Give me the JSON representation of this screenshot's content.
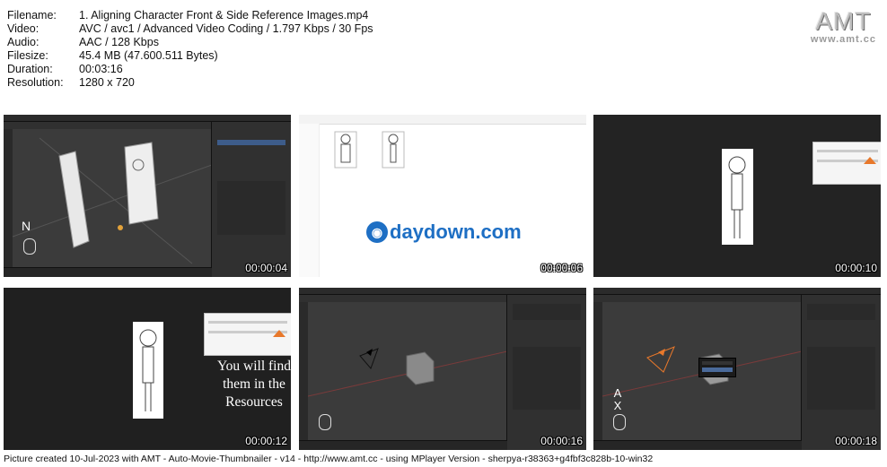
{
  "info": {
    "rows": [
      {
        "key": "Filename:",
        "value": "1. Aligning Character Front & Side Reference Images.mp4"
      },
      {
        "key": "Video:",
        "value": "AVC / avc1 / Advanced Video Coding / 1.797 Kbps / 30 Fps"
      },
      {
        "key": "Audio:",
        "value": "AAC / 128 Kbps"
      },
      {
        "key": "Filesize:",
        "value": "45.4 MB (47.600.511 Bytes)"
      },
      {
        "key": "Duration:",
        "value": "00:03:16"
      },
      {
        "key": "Resolution:",
        "value": "1280 x 720"
      }
    ]
  },
  "logo": {
    "title": "AMT",
    "url": "www.amt.cc"
  },
  "thumbnails": [
    {
      "timestamp": "00:00:04",
      "overlay": "N"
    },
    {
      "timestamp": "00:00:06",
      "watermark": "daydown.com"
    },
    {
      "timestamp": "00:00:10"
    },
    {
      "timestamp": "00:00:12",
      "caption": "You will find them in the Resources"
    },
    {
      "timestamp": "00:00:16"
    },
    {
      "timestamp": "00:00:18",
      "overlay": "A X"
    }
  ],
  "footer": "Picture created 10-Jul-2023 with AMT - Auto-Movie-Thumbnailer - v14 - http://www.amt.cc - using MPlayer Version - sherpya-r38363+g4fbf3c828b-10-win32"
}
